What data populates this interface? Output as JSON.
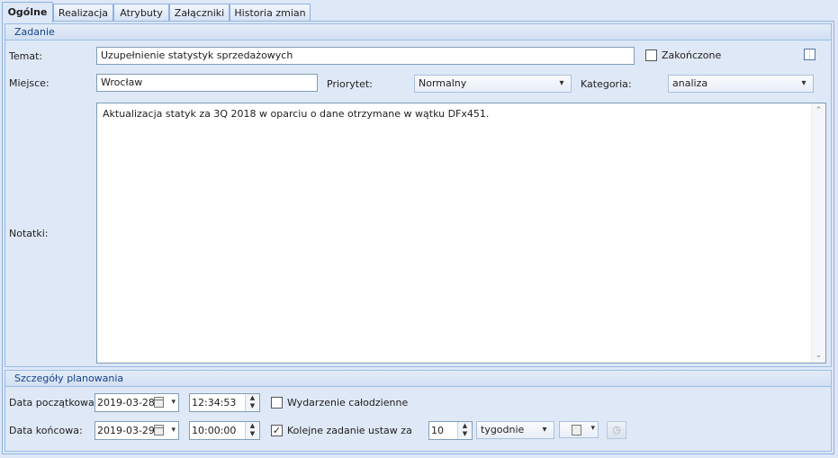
{
  "tabs": [
    "Ogólne",
    "Realizacja",
    "Atrybuty",
    "Załączniki",
    "Historia zmian"
  ],
  "zadanie": {
    "header": "Zadanie",
    "temat_label": "Temat:",
    "temat_value": "Uzupełnienie statystyk sprzedażowych",
    "zakonczone_label": "Zakończone",
    "miejsce_label": "Miejsce:",
    "miejsce_value": "Wrocław",
    "priorytet_label": "Priorytet:",
    "priorytet_value": "Normalny",
    "kategoria_label": "Kategoria:",
    "kategoria_value": "analiza",
    "notatki_label": "Notatki:",
    "notatki_value": "Aktualizacja statyk za 3Q 2018 w oparciu o dane otrzymane w wątku DFx451."
  },
  "planowanie": {
    "header": "Szczegóły planowania",
    "data_poczatkowa_label": "Data początkowa:",
    "data_poczatkowa_value": "2019-03-28",
    "czas_poczatkowy_value": "12:34:53",
    "wydarzenie_label": "Wydarzenie całodzienne",
    "data_koncowa_label": "Data końcowa:",
    "data_koncowa_value": "2019-03-29",
    "czas_koncowy_value": "10:00:00",
    "kolejne_label": "Kolejne zadanie ustaw za",
    "kolejne_checked": "✓",
    "interwal_value": "10",
    "okres_value": "tygodnie"
  },
  "icons": {
    "dropdown": "▾",
    "spin_up": "▲",
    "spin_down": "▼",
    "scroll_up": "⌃",
    "scroll_down": "⌄",
    "clock": "◷"
  }
}
